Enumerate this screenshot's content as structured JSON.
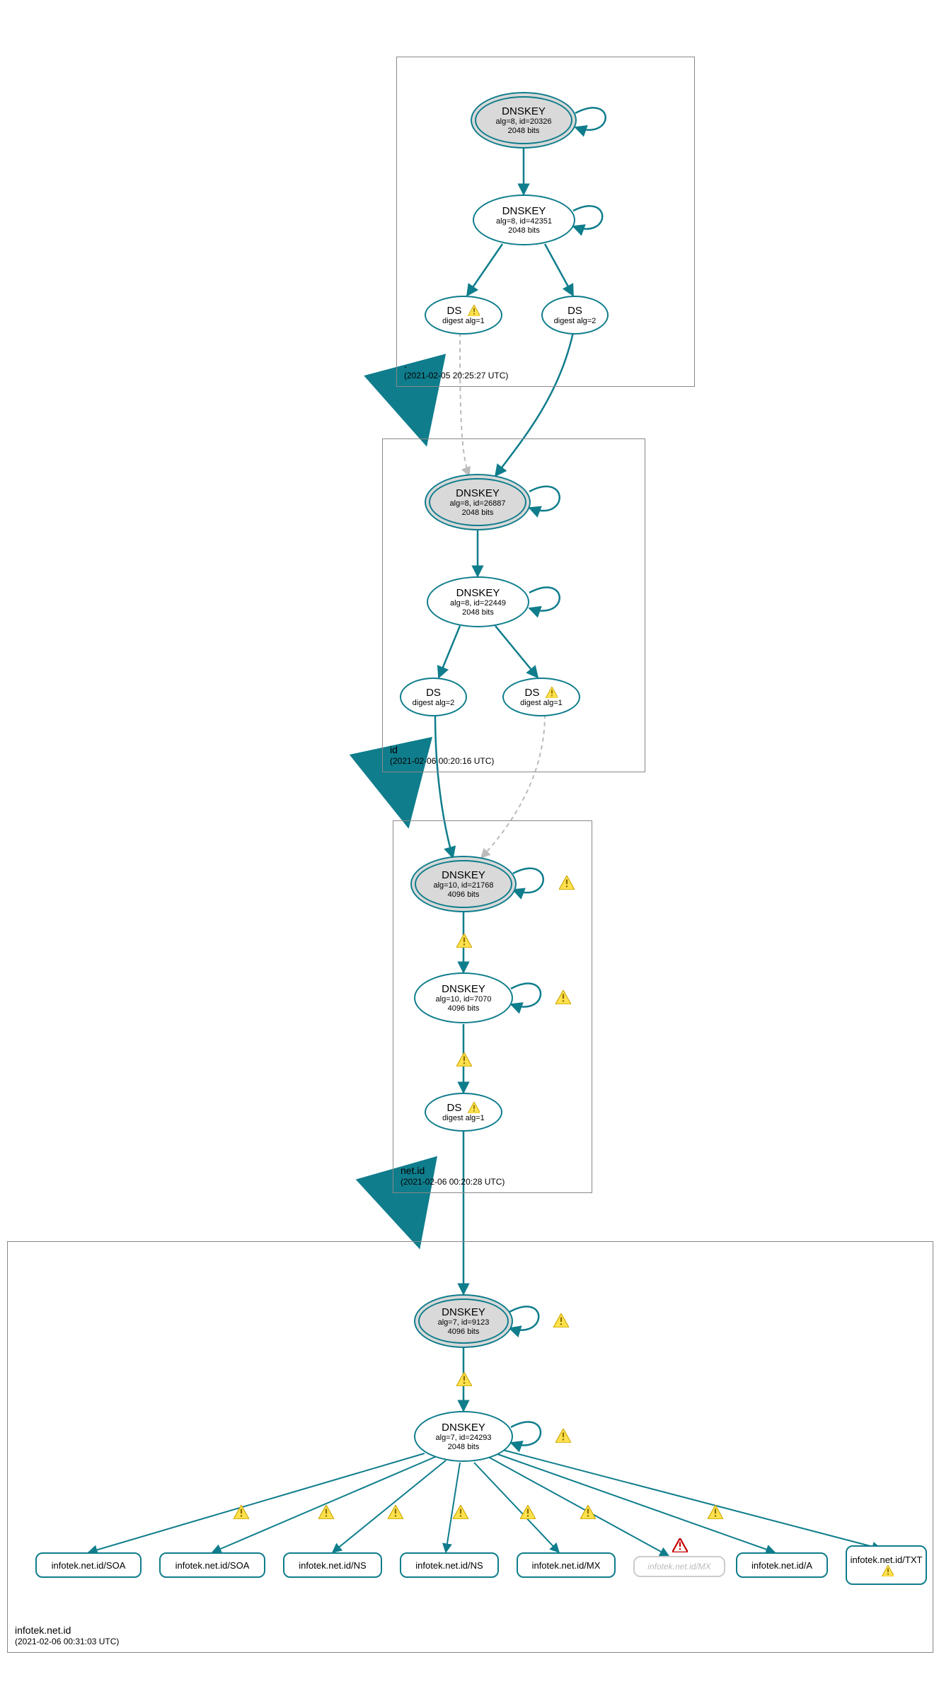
{
  "zones": {
    "root": {
      "name": ".",
      "timestamp": "(2021-02-05 20:25:27 UTC)"
    },
    "id": {
      "name": "id",
      "timestamp": "(2021-02-06 00:20:16 UTC)"
    },
    "netid": {
      "name": "net.id",
      "timestamp": "(2021-02-06 00:20:28 UTC)"
    },
    "infotek": {
      "name": "infotek.net.id",
      "timestamp": "(2021-02-06 00:31:03 UTC)"
    }
  },
  "nodes": {
    "root_ksk": {
      "title": "DNSKEY",
      "line1": "alg=8, id=20326",
      "line2": "2048 bits"
    },
    "root_zsk": {
      "title": "DNSKEY",
      "line1": "alg=8, id=42351",
      "line2": "2048 bits"
    },
    "root_ds1": {
      "title": "DS",
      "sub": "digest alg=1"
    },
    "root_ds2": {
      "title": "DS",
      "sub": "digest alg=2"
    },
    "id_ksk": {
      "title": "DNSKEY",
      "line1": "alg=8, id=26887",
      "line2": "2048 bits"
    },
    "id_zsk": {
      "title": "DNSKEY",
      "line1": "alg=8, id=22449",
      "line2": "2048 bits"
    },
    "id_ds1": {
      "title": "DS",
      "sub": "digest alg=1"
    },
    "id_ds2": {
      "title": "DS",
      "sub": "digest alg=2"
    },
    "netid_ksk": {
      "title": "DNSKEY",
      "line1": "alg=10, id=21768",
      "line2": "4096 bits"
    },
    "netid_zsk": {
      "title": "DNSKEY",
      "line1": "alg=10, id=7070",
      "line2": "4096 bits"
    },
    "netid_ds1": {
      "title": "DS",
      "sub": "digest alg=1"
    },
    "inf_ksk": {
      "title": "DNSKEY",
      "line1": "alg=7, id=9123",
      "line2": "4096 bits"
    },
    "inf_zsk": {
      "title": "DNSKEY",
      "line1": "alg=7, id=24293",
      "line2": "2048 bits"
    }
  },
  "rrsets": {
    "soa1": "infotek.net.id/SOA",
    "soa2": "infotek.net.id/SOA",
    "ns1": "infotek.net.id/NS",
    "ns2": "infotek.net.id/NS",
    "mx1": "infotek.net.id/MX",
    "mx2": "infotek.net.id/MX",
    "a": "infotek.net.id/A",
    "txt": "infotek.net.id/TXT"
  }
}
